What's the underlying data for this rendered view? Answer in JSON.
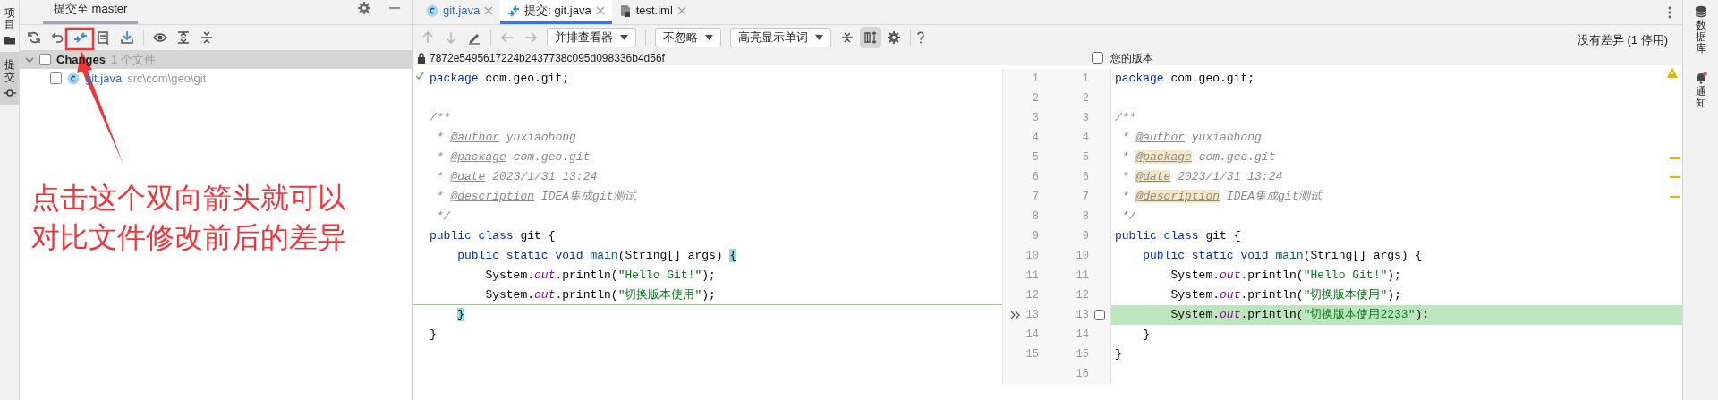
{
  "left_tool_strip": [
    {
      "label": "项目",
      "kind": "folder",
      "selected": false
    },
    {
      "label": "提交",
      "kind": "commit",
      "selected": true
    }
  ],
  "commit_panel": {
    "title": "提交至 master",
    "changes_group": {
      "label": "Changes",
      "count": "1 个文件",
      "checked": false,
      "expanded": true
    },
    "files": [
      {
        "name": "git.java",
        "path": "src\\com\\geo\\git",
        "checked": false
      }
    ]
  },
  "editor_tabs": [
    {
      "label": "git.java",
      "kind": "class",
      "selected": false
    },
    {
      "label": "提交: git.java",
      "kind": "diff",
      "selected": true
    },
    {
      "label": "test.iml",
      "kind": "file",
      "selected": false
    }
  ],
  "diff_toolbar": {
    "viewer": "并排查看器",
    "ignore": "不忽略",
    "highlight": "高亮显示单词",
    "side_by_side_selected": true,
    "status": "没有差异 (1 停用)"
  },
  "left_header": {
    "revision": "7872e5495617224b2437738c095d098336b4d56f"
  },
  "right_header": {
    "label": "您的版本",
    "checked": false
  },
  "rows": [
    {
      "changed": false,
      "left": {
        "number": "1",
        "segments": [
          {
            "kind": "keyword",
            "text": "package"
          },
          {
            "kind": "plain",
            "text": " com.geo.git;"
          }
        ]
      },
      "right": {
        "number": "1",
        "segments": [
          {
            "kind": "keyword",
            "text": "package"
          },
          {
            "kind": "plain",
            "text": " com.geo.git;"
          }
        ]
      }
    },
    {
      "changed": false,
      "left": {
        "number": "2"
      },
      "right": {
        "number": "2"
      }
    },
    {
      "changed": false,
      "left": {
        "number": "3",
        "segments": [
          {
            "kind": "comment",
            "text": "/**"
          }
        ]
      },
      "right": {
        "number": "3",
        "segments": [
          {
            "kind": "comment",
            "text": "/**"
          }
        ]
      }
    },
    {
      "changed": false,
      "left": {
        "number": "4",
        "segments": [
          {
            "kind": "comment",
            "text": " * "
          },
          {
            "kind": "doctag",
            "text": "@author"
          },
          {
            "kind": "comment",
            "text": " yuxiaohong"
          }
        ]
      },
      "right": {
        "number": "4",
        "segments": [
          {
            "kind": "comment",
            "text": " * "
          },
          {
            "kind": "doctag",
            "text": "@author"
          },
          {
            "kind": "comment",
            "text": " yuxiaohong"
          }
        ]
      }
    },
    {
      "changed": false,
      "left": {
        "number": "5",
        "segments": [
          {
            "kind": "comment",
            "text": " * "
          },
          {
            "kind": "doctag",
            "text": "@package"
          },
          {
            "kind": "comment",
            "text": " com.geo.git"
          }
        ]
      },
      "right": {
        "number": "5",
        "segments": [
          {
            "kind": "comment",
            "text": " * "
          },
          {
            "kind": "doctag-marked",
            "text": "@package"
          },
          {
            "kind": "comment",
            "text": " com.geo.git"
          }
        ]
      }
    },
    {
      "changed": false,
      "left": {
        "number": "6",
        "segments": [
          {
            "kind": "comment",
            "text": " * "
          },
          {
            "kind": "doctag",
            "text": "@date"
          },
          {
            "kind": "comment",
            "text": " 2023/1/31 13:24"
          }
        ]
      },
      "right": {
        "number": "6",
        "segments": [
          {
            "kind": "comment",
            "text": " * "
          },
          {
            "kind": "doctag-marked",
            "text": "@date"
          },
          {
            "kind": "comment",
            "text": " 2023/1/31 13:24"
          }
        ]
      }
    },
    {
      "changed": false,
      "left": {
        "number": "7",
        "segments": [
          {
            "kind": "comment",
            "text": " * "
          },
          {
            "kind": "doctag",
            "text": "@description"
          },
          {
            "kind": "comment",
            "text": " IDEA集成git测试"
          }
        ]
      },
      "right": {
        "number": "7",
        "segments": [
          {
            "kind": "comment",
            "text": " * "
          },
          {
            "kind": "doctag-marked",
            "text": "@description"
          },
          {
            "kind": "comment",
            "text": " IDEA集成git测试"
          }
        ]
      }
    },
    {
      "changed": false,
      "left": {
        "number": "8",
        "segments": [
          {
            "kind": "comment",
            "text": " */"
          }
        ]
      },
      "right": {
        "number": "8",
        "segments": [
          {
            "kind": "comment",
            "text": " */"
          }
        ]
      }
    },
    {
      "changed": false,
      "left": {
        "number": "9",
        "segments": [
          {
            "kind": "keyword",
            "text": "public class"
          },
          {
            "kind": "plain",
            "text": " git {"
          }
        ]
      },
      "right": {
        "number": "9",
        "segments": [
          {
            "kind": "keyword",
            "text": "public class"
          },
          {
            "kind": "plain",
            "text": " git {"
          }
        ]
      }
    },
    {
      "changed": false,
      "left": {
        "number": "10",
        "segments": [
          {
            "kind": "keyword",
            "text": "    public static void"
          },
          {
            "kind": "method",
            "text": " main"
          },
          {
            "kind": "plain",
            "text": "(String[] args) "
          },
          {
            "kind": "brace-match",
            "text": "{"
          }
        ]
      },
      "right": {
        "number": "10",
        "segments": [
          {
            "kind": "keyword",
            "text": "    public static void"
          },
          {
            "kind": "method",
            "text": " main"
          },
          {
            "kind": "plain",
            "text": "(String[] args) {"
          }
        ]
      }
    },
    {
      "changed": false,
      "left": {
        "number": "11",
        "segments": [
          {
            "kind": "plain",
            "text": "        System."
          },
          {
            "kind": "field",
            "text": "out"
          },
          {
            "kind": "plain",
            "text": ".println("
          },
          {
            "kind": "string",
            "text": "\"Hello Git!\""
          },
          {
            "kind": "plain",
            "text": ");"
          }
        ]
      },
      "right": {
        "number": "11",
        "segments": [
          {
            "kind": "plain",
            "text": "        System."
          },
          {
            "kind": "field",
            "text": "out"
          },
          {
            "kind": "plain",
            "text": ".println("
          },
          {
            "kind": "string",
            "text": "\"Hello Git!\""
          },
          {
            "kind": "plain",
            "text": ");"
          }
        ]
      }
    },
    {
      "changed": false,
      "left": {
        "number": "12",
        "segments": [
          {
            "kind": "plain",
            "text": "        System."
          },
          {
            "kind": "field",
            "text": "out"
          },
          {
            "kind": "plain",
            "text": ".println("
          },
          {
            "kind": "string",
            "text": "\"切换版本使用\""
          },
          {
            "kind": "plain",
            "text": ");"
          }
        ]
      },
      "right": {
        "number": "12",
        "segments": [
          {
            "kind": "plain",
            "text": "        System."
          },
          {
            "kind": "field",
            "text": "out"
          },
          {
            "kind": "plain",
            "text": ".println("
          },
          {
            "kind": "string",
            "text": "\"切换版本使用\""
          },
          {
            "kind": "plain",
            "text": ");"
          }
        ]
      }
    },
    {
      "changed": true,
      "left": {
        "number": "13",
        "indented": true,
        "segments": [
          {
            "kind": "brace-match",
            "text": "}"
          }
        ]
      },
      "right": {
        "number": "13",
        "segments": [
          {
            "kind": "plain",
            "text": "        System."
          },
          {
            "kind": "field",
            "text": "out"
          },
          {
            "kind": "plain",
            "text": ".println("
          },
          {
            "kind": "string",
            "text": "\"切换版本使用2233\""
          },
          {
            "kind": "plain",
            "text": ");"
          }
        ]
      }
    },
    {
      "changed": false,
      "left": {
        "number": "14",
        "segments": [
          {
            "kind": "plain",
            "text": "}"
          }
        ]
      },
      "right": {
        "number": "14",
        "segments": [
          {
            "kind": "plain",
            "text": "    }"
          }
        ]
      }
    },
    {
      "changed": false,
      "left": {
        "number": "15"
      },
      "right": {
        "number": "15",
        "segments": [
          {
            "kind": "plain",
            "text": "}"
          }
        ]
      }
    },
    {
      "changed": false,
      "right": {
        "number": "16"
      }
    }
  ],
  "right_tool_strip": [
    {
      "label": "数据库",
      "kind": "database"
    },
    {
      "label": "通知",
      "kind": "bell"
    }
  ],
  "annotation": {
    "lines": [
      "点击这个双向箭头就可以",
      "对比文件修改前后的差异"
    ]
  }
}
